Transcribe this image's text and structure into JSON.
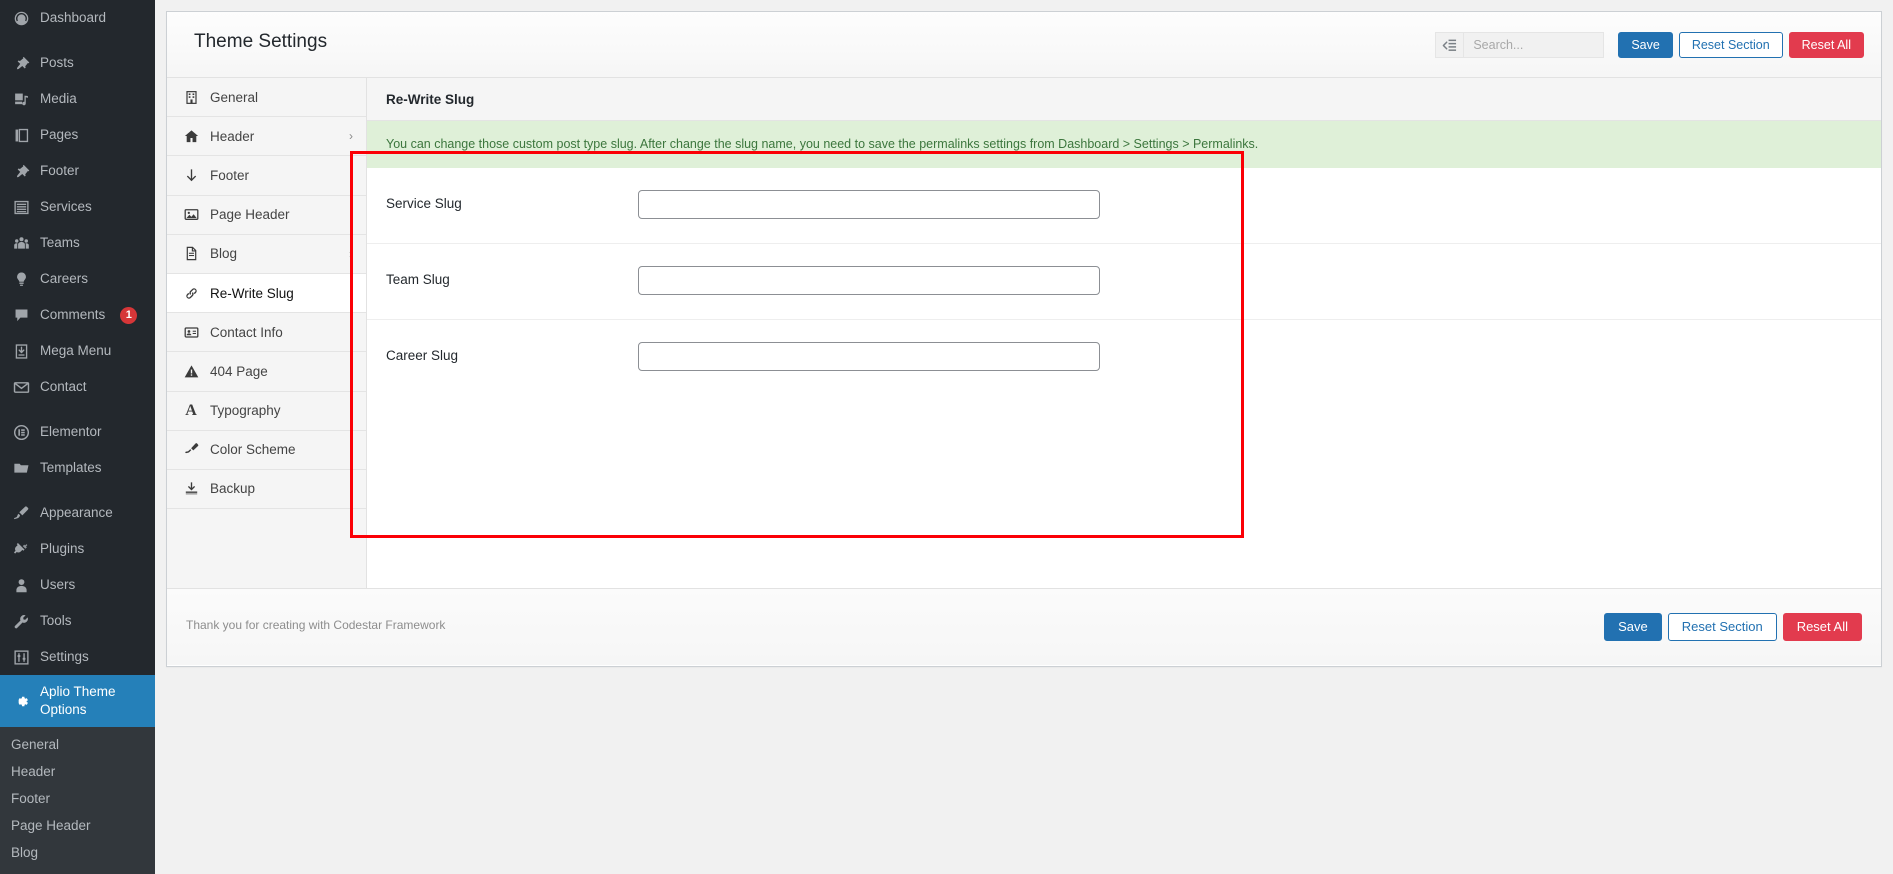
{
  "admin_menu": {
    "items": [
      {
        "label": "Dashboard",
        "icon": "dashboard-icon",
        "name": "dashboard"
      },
      {
        "separator": true
      },
      {
        "label": "Posts",
        "icon": "pin-icon",
        "name": "posts"
      },
      {
        "label": "Media",
        "icon": "media-icon",
        "name": "media"
      },
      {
        "label": "Pages",
        "icon": "pages-icon",
        "name": "pages"
      },
      {
        "label": "Footer",
        "icon": "pin-icon",
        "name": "footer"
      },
      {
        "label": "Services",
        "icon": "list-icon",
        "name": "services"
      },
      {
        "label": "Teams",
        "icon": "group-icon",
        "name": "teams"
      },
      {
        "label": "Careers",
        "icon": "lightbulb-icon",
        "name": "careers"
      },
      {
        "label": "Comments",
        "icon": "comment-icon",
        "name": "comments",
        "badge": "1"
      },
      {
        "label": "Mega Menu",
        "icon": "download-box-icon",
        "name": "mega-menu"
      },
      {
        "label": "Contact",
        "icon": "envelope-icon",
        "name": "contact"
      },
      {
        "separator": true
      },
      {
        "label": "Elementor",
        "icon": "elementor-icon",
        "name": "elementor"
      },
      {
        "label": "Templates",
        "icon": "folder-icon",
        "name": "templates"
      },
      {
        "separator": true
      },
      {
        "label": "Appearance",
        "icon": "paintbrush-icon",
        "name": "appearance"
      },
      {
        "label": "Plugins",
        "icon": "plug-icon",
        "name": "plugins"
      },
      {
        "label": "Users",
        "icon": "user-icon",
        "name": "users"
      },
      {
        "label": "Tools",
        "icon": "wrench-icon",
        "name": "tools"
      },
      {
        "label": "Settings",
        "icon": "sliders-icon",
        "name": "settings"
      },
      {
        "label": "Aplio Theme Options",
        "icon": "gear-icon",
        "name": "aplio-theme-options",
        "current": true,
        "wide": true
      }
    ],
    "submenu": [
      {
        "label": "General",
        "name": "general"
      },
      {
        "label": "Header",
        "name": "header"
      },
      {
        "label": "Footer",
        "name": "footer"
      },
      {
        "label": "Page Header",
        "name": "page-header"
      },
      {
        "label": "Blog",
        "name": "blog"
      }
    ]
  },
  "header": {
    "title": "Theme Settings",
    "expand_icon": "collapse-panel-icon",
    "search_placeholder": "Search...",
    "search_value": "",
    "save_label": "Save",
    "reset_section_label": "Reset Section",
    "reset_all_label": "Reset All"
  },
  "settings_nav": {
    "items": [
      {
        "label": "General",
        "icon": "building-icon",
        "name": "general",
        "arrow": false,
        "active": false
      },
      {
        "label": "Header",
        "icon": "home-icon",
        "name": "header",
        "arrow": true,
        "active": false
      },
      {
        "label": "Footer",
        "icon": "arrow-down-icon",
        "name": "footer",
        "arrow": false,
        "active": false
      },
      {
        "label": "Page Header",
        "icon": "image-icon",
        "name": "page-header",
        "arrow": false,
        "active": false
      },
      {
        "label": "Blog",
        "icon": "document-icon",
        "name": "blog",
        "arrow": true,
        "active": false
      },
      {
        "label": "Re-Write Slug",
        "icon": "link-icon",
        "name": "re-write-slug",
        "arrow": false,
        "active": true
      },
      {
        "label": "Contact Info",
        "icon": "contact-card-icon",
        "name": "contact-info",
        "arrow": false,
        "active": false
      },
      {
        "label": "404 Page",
        "icon": "warning-icon",
        "name": "404-page",
        "arrow": false,
        "active": false
      },
      {
        "label": "Typography",
        "icon": "letter-a-icon",
        "name": "typography",
        "arrow": false,
        "active": false
      },
      {
        "label": "Color Scheme",
        "icon": "brush-icon",
        "name": "color-scheme",
        "arrow": false,
        "active": false
      },
      {
        "label": "Backup",
        "icon": "download-icon",
        "name": "backup",
        "arrow": false,
        "active": false
      }
    ]
  },
  "section": {
    "title": "Re-Write Slug",
    "notice": "You can change those custom post type slug. After change the slug name, you need to save the permalinks settings from Dashboard > Settings > Permalinks.",
    "fields": [
      {
        "label": "Service Slug",
        "value": "",
        "name": "service-slug"
      },
      {
        "label": "Team Slug",
        "value": "",
        "name": "team-slug"
      },
      {
        "label": "Career Slug",
        "value": "",
        "name": "career-slug"
      }
    ]
  },
  "footer": {
    "credit": "Thank you for creating with Codestar Framework",
    "save_label": "Save",
    "reset_section_label": "Reset Section",
    "reset_all_label": "Reset All"
  },
  "colors": {
    "accent_blue": "#2271b1",
    "danger_red": "#e23b4e",
    "highlight_red": "#fb0006",
    "notice_green_bg": "#dff0d8",
    "notice_green_text": "#3c763d",
    "sidebar_bg": "#23282d",
    "sidebar_current": "#2580b9"
  }
}
